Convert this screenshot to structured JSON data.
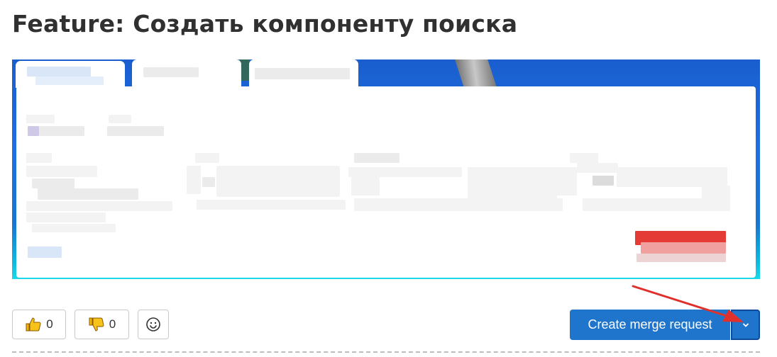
{
  "issue": {
    "title": "Feature: Создать компоненту поиска"
  },
  "reactions": [
    {
      "name": "thumbs-up",
      "count": "0"
    },
    {
      "name": "thumbs-down",
      "count": "0"
    }
  ],
  "actions": {
    "create_merge_request_label": "Create merge request"
  },
  "colors": {
    "primary_button": "#1f75cb",
    "annotation_arrow": "#e0302b",
    "title_text": "#303030"
  }
}
